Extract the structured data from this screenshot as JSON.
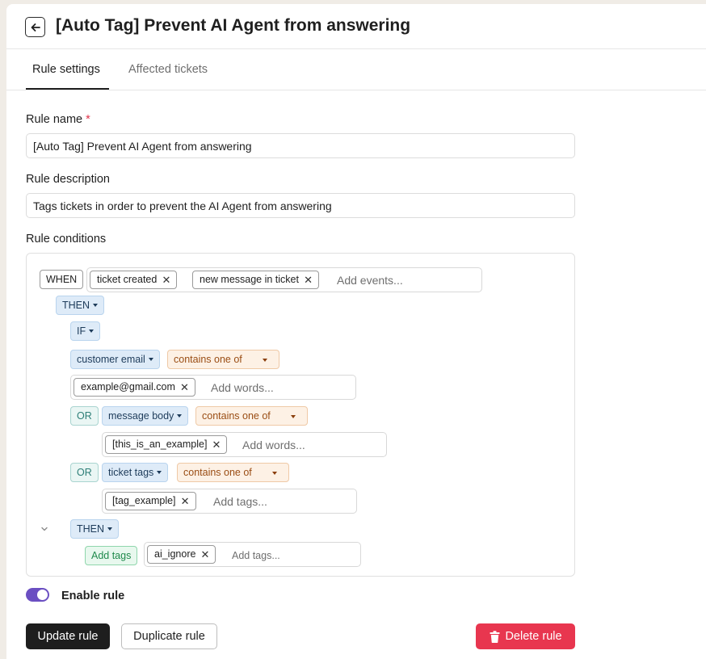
{
  "header": {
    "title": "[Auto Tag] Prevent AI Agent from answering"
  },
  "tabs": [
    {
      "label": "Rule settings",
      "active": true
    },
    {
      "label": "Affected tickets",
      "active": false
    }
  ],
  "form": {
    "rule_name": {
      "label": "Rule name",
      "required_mark": "*",
      "value": "[Auto Tag] Prevent AI Agent from answering"
    },
    "rule_description": {
      "label": "Rule description",
      "value": "Tags tickets in order to prevent the AI Agent from answering"
    },
    "rule_conditions": {
      "label": "Rule conditions"
    }
  },
  "conditions": {
    "when_label": "WHEN",
    "events": [
      "ticket created",
      "new message in ticket"
    ],
    "events_placeholder": "Add events...",
    "then_label": "THEN",
    "if_label": "IF",
    "or_label": "OR",
    "clauses": [
      {
        "field": "customer email",
        "operator": "contains one of",
        "values": [
          "example@gmail.com"
        ],
        "placeholder": "Add words..."
      },
      {
        "field": "message body",
        "operator": "contains one of",
        "values": [
          "[this_is_an_example]"
        ],
        "placeholder": "Add words..."
      },
      {
        "field": "ticket tags",
        "operator": "contains one of",
        "values": [
          "[tag_example]"
        ],
        "placeholder": "Add tags..."
      }
    ],
    "action": {
      "then_label": "THEN",
      "name": "Add tags",
      "values": [
        "ai_ignore"
      ],
      "placeholder": "Add tags..."
    }
  },
  "enable_rule": {
    "label": "Enable rule",
    "enabled": true
  },
  "buttons": {
    "update": "Update rule",
    "duplicate": "Duplicate rule",
    "delete": "Delete rule"
  },
  "colors": {
    "accent_toggle": "#6b4fc2",
    "danger": "#e8364f",
    "primary": "#1e1e1e"
  },
  "icons": {
    "back": "arrow-left-icon",
    "remove": "close-icon",
    "collapse": "chevron-down-icon",
    "delete": "trash-icon"
  }
}
